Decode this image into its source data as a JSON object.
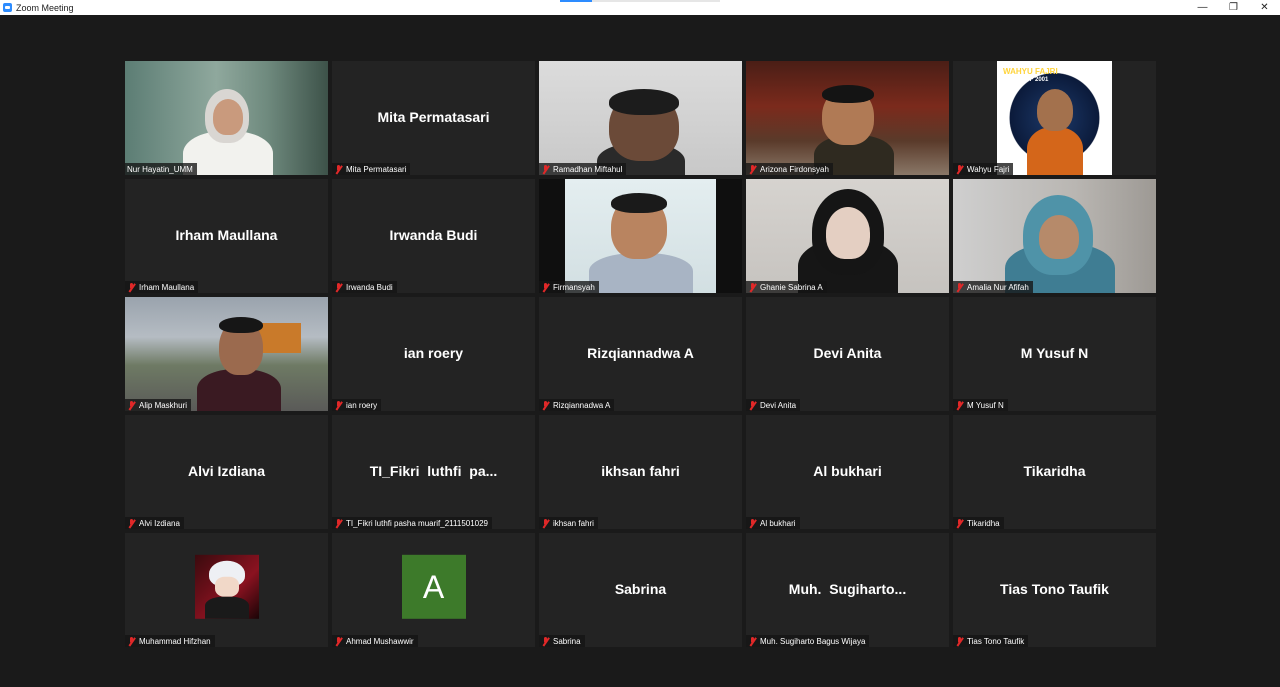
{
  "window": {
    "title": "Zoom Meeting",
    "controls": {
      "minimize": "—",
      "restore": "❐",
      "close": "✕"
    },
    "progress": 0.2
  },
  "participants": [
    {
      "label": "Nur Hayatin_UMM",
      "video": true,
      "muted": false
    },
    {
      "label": "Mita Permatasari",
      "display": "Mita Permatasari",
      "muted": true
    },
    {
      "label": "Ramadhan Miftahul",
      "video": true,
      "muted": true
    },
    {
      "label": "Arizona Firdonsyah",
      "video": true,
      "muted": true
    },
    {
      "label": "Wahyu Fajri",
      "video": true,
      "muted": true,
      "poster_title": "WAHYU FAJRI",
      "poster_sub": "CLASS OF 2001"
    },
    {
      "label": "Irham Maullana",
      "display": "Irham Maullana",
      "muted": true
    },
    {
      "label": "Irwanda Budi",
      "display": "Irwanda Budi",
      "muted": true
    },
    {
      "label": "Firmansyah",
      "video": true,
      "muted": true
    },
    {
      "label": "Ghanie Sabrina A",
      "video": true,
      "muted": true
    },
    {
      "label": "Amalia Nur Afifah",
      "video": true,
      "muted": true
    },
    {
      "label": "Alip Maskhuri",
      "video": true,
      "muted": true
    },
    {
      "label": "ian roery",
      "display": "ian roery",
      "muted": true
    },
    {
      "label": "Rizqiannadwa A",
      "display": "Rizqiannadwa A",
      "muted": true
    },
    {
      "label": "Devi Anita",
      "display": "Devi Anita",
      "muted": true
    },
    {
      "label": "M Yusuf N",
      "display": "M Yusuf N",
      "muted": true
    },
    {
      "label": "Alvi Izdiana",
      "display": "Alvi Izdiana",
      "muted": true
    },
    {
      "label": "TI_Fikri luthfi pasha muarif_2111501029",
      "display": "TI_Fikri  luthfi  pa...",
      "muted": true
    },
    {
      "label": "ikhsan fahri",
      "display": "ikhsan fahri",
      "muted": true
    },
    {
      "label": "Al bukhari",
      "display": "Al bukhari",
      "muted": true
    },
    {
      "label": "Tikaridha",
      "display": "Tikaridha",
      "muted": true
    },
    {
      "label": "Muhammad Hifzhan",
      "avatar": "anime-avatar",
      "muted": true
    },
    {
      "label": "Ahmad Mushawwir",
      "avatar_letter": "A",
      "muted": true
    },
    {
      "label": "Sabrina",
      "display": "Sabrina",
      "muted": true
    },
    {
      "label": "Muh. Sugiharto Bagus Wijaya",
      "display": "Muh.  Sugiharto...",
      "muted": true
    },
    {
      "label": "Tias Tono Taufik",
      "display": "Tias Tono Taufik",
      "muted": true
    }
  ],
  "colors": {
    "background": "#1a1a1a",
    "tile": "#232323",
    "muted_icon": "#e02828",
    "zoom_blue": "#2d8cff",
    "avatar_green": "#3d7a2a"
  }
}
